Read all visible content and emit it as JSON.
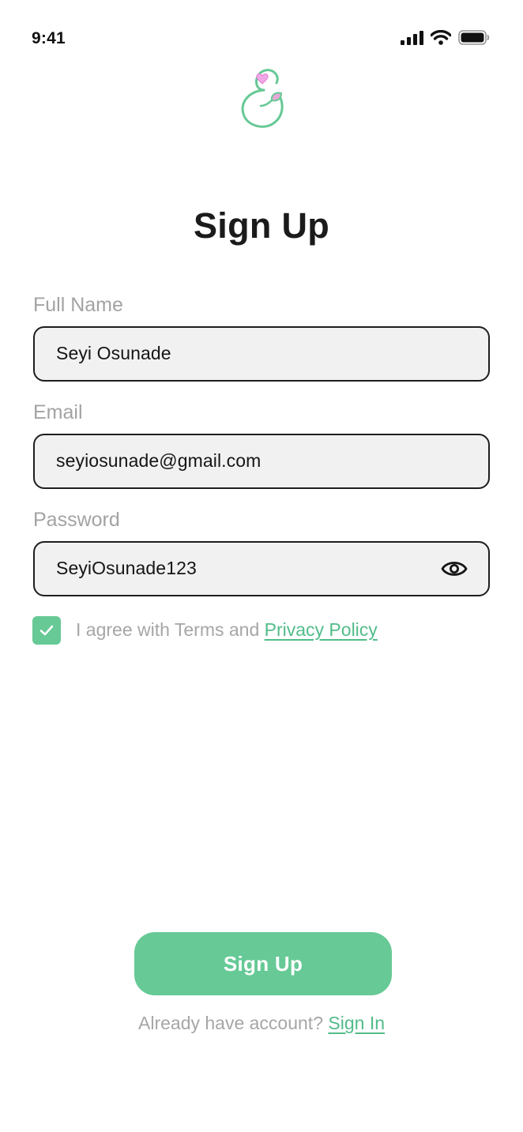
{
  "status_bar": {
    "time": "9:41",
    "icons": [
      "cellular-signal-icon",
      "wifi-icon",
      "battery-icon"
    ]
  },
  "logo": {
    "icon": "pregnancy-heart-logo",
    "colors": {
      "outline": "#66c996",
      "heart": "#f2a7e6",
      "leaf": "#e6a8d7"
    }
  },
  "title": "Sign Up",
  "form": {
    "full_name": {
      "label": "Full Name",
      "value": "Seyi Osunade"
    },
    "email": {
      "label": "Email",
      "value": "seyiosunade@gmail.com"
    },
    "password": {
      "label": "Password",
      "value": "SeyiOsunade123",
      "toggle_icon": "eye-icon"
    }
  },
  "agreement": {
    "checked": true,
    "text": "I agree with Terms and ",
    "link": "Privacy Policy"
  },
  "signup_button": {
    "label": "Sign Up"
  },
  "signin": {
    "prompt": "Already have account? ",
    "link": "Sign In"
  },
  "colors": {
    "accent": "#66c996",
    "link": "#52bc8a",
    "label": "#a3a3a3",
    "input_bg": "#f0f1f0",
    "input_border": "#1e1e1e"
  }
}
